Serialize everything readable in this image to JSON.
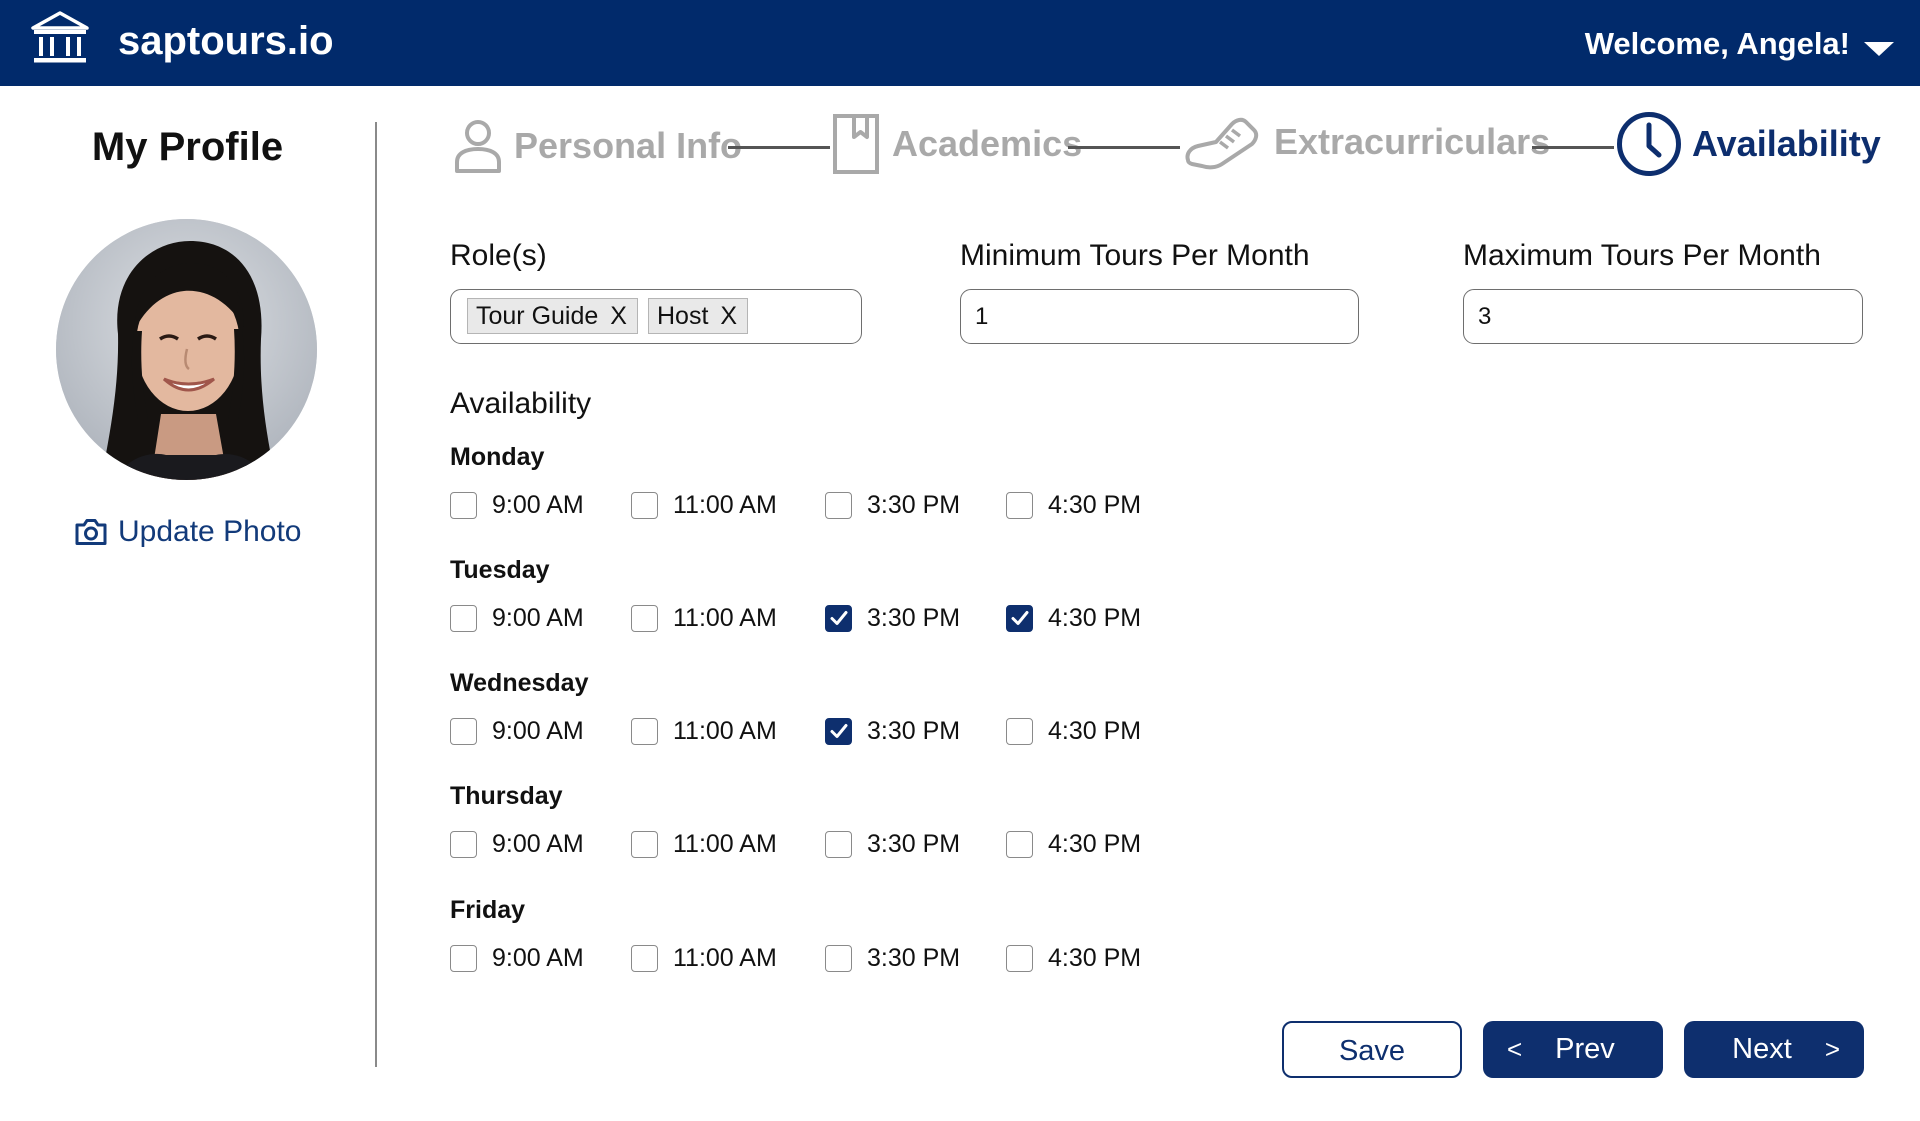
{
  "header": {
    "brand": "saptours.io",
    "welcome": "Welcome, Angela!",
    "logo_icon": "building-columns-icon",
    "menu_icon": "caret-down-icon"
  },
  "sidebar": {
    "title": "My Profile",
    "update_photo_label": "Update Photo",
    "update_photo_icon": "camera-icon"
  },
  "stepper": {
    "steps": [
      {
        "label": "Personal Info",
        "icon": "person-icon",
        "state": "inactive"
      },
      {
        "label": "Academics",
        "icon": "bookmark-icon",
        "state": "inactive"
      },
      {
        "label": "Extracurriculars",
        "icon": "sneaker-icon",
        "state": "inactive"
      },
      {
        "label": "Availability",
        "icon": "clock-icon",
        "state": "active"
      }
    ]
  },
  "form": {
    "roles_label": "Role(s)",
    "roles": [
      {
        "label": "Tour Guide",
        "remove": "X"
      },
      {
        "label": "Host",
        "remove": "X"
      }
    ],
    "min_label": "Minimum Tours Per Month",
    "min_value": "1",
    "max_label": "Maximum Tours Per Month",
    "max_value": "3"
  },
  "availability": {
    "title": "Availability",
    "times": [
      "9:00 AM",
      "11:00 AM",
      "3:30 PM",
      "4:30 PM"
    ],
    "days": [
      {
        "name": "Monday",
        "checked": [
          false,
          false,
          false,
          false
        ]
      },
      {
        "name": "Tuesday",
        "checked": [
          false,
          false,
          true,
          true
        ]
      },
      {
        "name": "Wednesday",
        "checked": [
          false,
          false,
          true,
          false
        ]
      },
      {
        "name": "Thursday",
        "checked": [
          false,
          false,
          false,
          false
        ]
      },
      {
        "name": "Friday",
        "checked": [
          false,
          false,
          false,
          false
        ]
      }
    ]
  },
  "buttons": {
    "save": "Save",
    "prev": "Prev",
    "prev_arrow": "<",
    "next": "Next",
    "next_arrow": ">"
  },
  "colors": {
    "header_bg": "#012a6b",
    "accent": "#0e2f6e",
    "inactive_step": "#a9a9a9"
  }
}
